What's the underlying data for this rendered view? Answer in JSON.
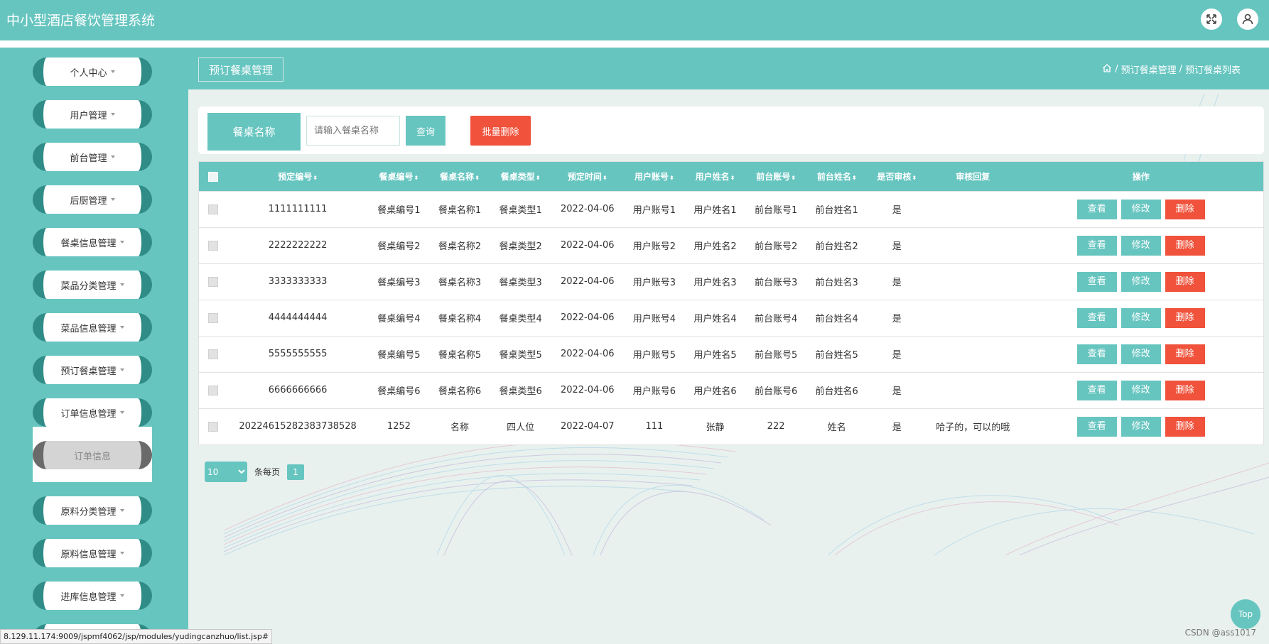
{
  "app": {
    "title": "中小型酒店餐饮管理系统"
  },
  "topbar": {
    "fullscreen_icon": "fullscreen-icon",
    "user_icon": "user-icon"
  },
  "sidebar": {
    "items": [
      {
        "label": "个人中心"
      },
      {
        "label": "用户管理"
      },
      {
        "label": "前台管理"
      },
      {
        "label": "后厨管理"
      },
      {
        "label": "餐桌信息管理"
      },
      {
        "label": "菜品分类管理"
      },
      {
        "label": "菜品信息管理"
      },
      {
        "label": "预订餐桌管理"
      },
      {
        "label": "订单信息管理"
      },
      {
        "label": "原料分类管理"
      },
      {
        "label": "原料信息管理"
      },
      {
        "label": "进库信息管理"
      }
    ],
    "submenu": {
      "label": "订单信息"
    }
  },
  "page": {
    "tag": "预订餐桌管理",
    "breadcrumb": {
      "level1": "预订餐桌管理",
      "level2": "预订餐桌列表",
      "separator": "/"
    }
  },
  "search": {
    "label": "餐桌名称",
    "placeholder": "请输入餐桌名称",
    "query_button": "查询",
    "batch_delete_button": "批量删除"
  },
  "table": {
    "columns": [
      "预定编号",
      "餐桌编号",
      "餐桌名称",
      "餐桌类型",
      "预定时间",
      "用户账号",
      "用户姓名",
      "前台账号",
      "前台姓名",
      "是否审核",
      "审核回复",
      "操作"
    ],
    "sort_glyph": "⬍",
    "actions": {
      "view": "查看",
      "edit": "修改",
      "delete": "删除"
    },
    "rows": [
      [
        "1111111111",
        "餐桌编号1",
        "餐桌名称1",
        "餐桌类型1",
        "2022-04-06",
        "用户账号1",
        "用户姓名1",
        "前台账号1",
        "前台姓名1",
        "是",
        ""
      ],
      [
        "2222222222",
        "餐桌编号2",
        "餐桌名称2",
        "餐桌类型2",
        "2022-04-06",
        "用户账号2",
        "用户姓名2",
        "前台账号2",
        "前台姓名2",
        "是",
        ""
      ],
      [
        "3333333333",
        "餐桌编号3",
        "餐桌名称3",
        "餐桌类型3",
        "2022-04-06",
        "用户账号3",
        "用户姓名3",
        "前台账号3",
        "前台姓名3",
        "是",
        ""
      ],
      [
        "4444444444",
        "餐桌编号4",
        "餐桌名称4",
        "餐桌类型4",
        "2022-04-06",
        "用户账号4",
        "用户姓名4",
        "前台账号4",
        "前台姓名4",
        "是",
        ""
      ],
      [
        "5555555555",
        "餐桌编号5",
        "餐桌名称5",
        "餐桌类型5",
        "2022-04-06",
        "用户账号5",
        "用户姓名5",
        "前台账号5",
        "前台姓名5",
        "是",
        ""
      ],
      [
        "6666666666",
        "餐桌编号6",
        "餐桌名称6",
        "餐桌类型6",
        "2022-04-06",
        "用户账号6",
        "用户姓名6",
        "前台账号6",
        "前台姓名6",
        "是",
        ""
      ],
      [
        "20224615282383738528",
        "1252",
        "名称",
        "四人位",
        "2022-04-07",
        "111",
        "张静",
        "222",
        "姓名",
        "是",
        "哈子的，可以的哦"
      ]
    ]
  },
  "pager": {
    "page_size": "10",
    "per_page_label": "条每页",
    "current_page": "1"
  },
  "top_button": "Top",
  "watermark": "CSDN @ass1017",
  "status_url": "8.129.11.174:9009/jspmf4062/jsp/modules/yudingcanzhuo/list.jsp#",
  "colors": {
    "primary": "#67c5c0",
    "sidebar_accent": "#2f8c86",
    "danger": "#f0523b",
    "background": "#e8f1ee"
  }
}
